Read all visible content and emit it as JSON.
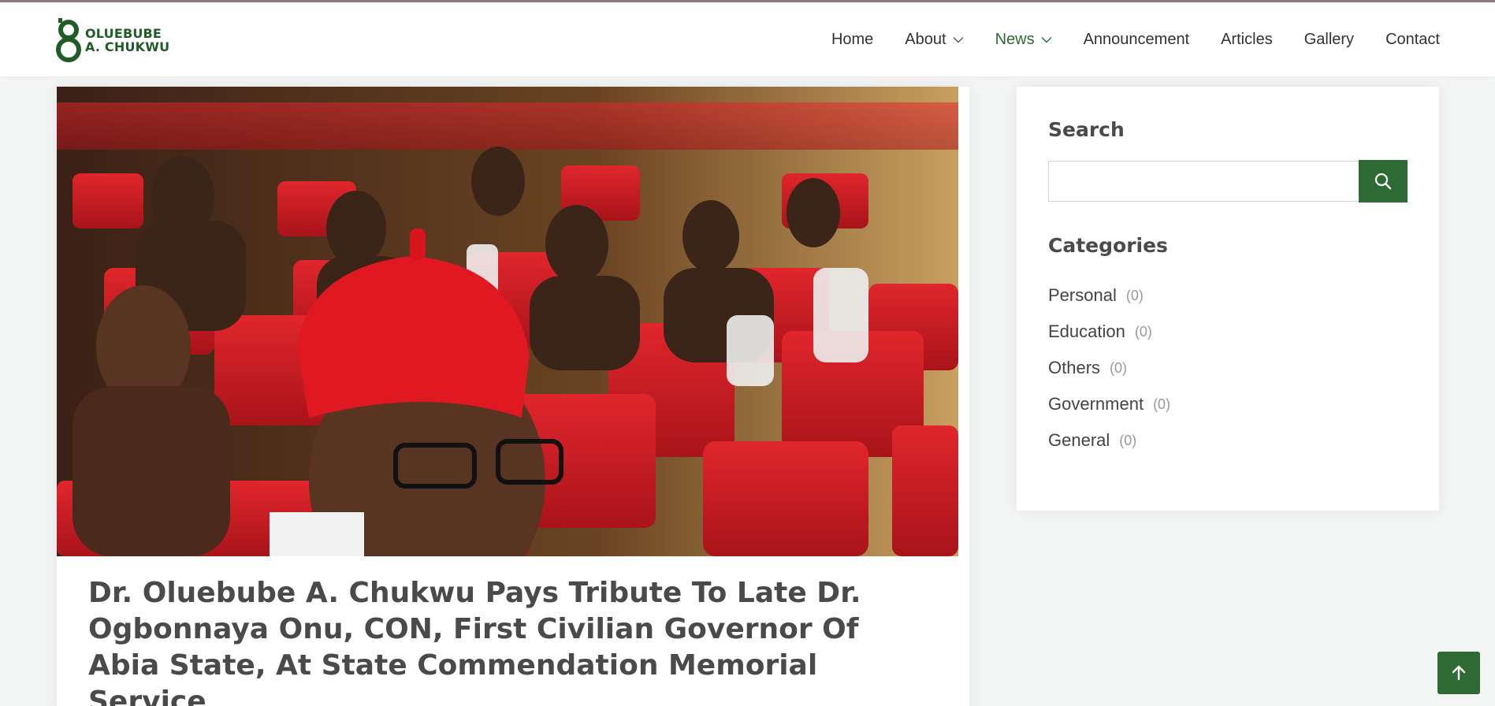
{
  "site": {
    "logo_line1": "OLUEBUBE",
    "logo_line2": "A. CHUKWU",
    "brand_color": "#2e6a34"
  },
  "nav": {
    "items": [
      {
        "label": "Home",
        "dropdown": false,
        "active": false
      },
      {
        "label": "About",
        "dropdown": true,
        "active": false
      },
      {
        "label": "News",
        "dropdown": true,
        "active": true
      },
      {
        "label": "Announcement",
        "dropdown": false,
        "active": false
      },
      {
        "label": "Articles",
        "dropdown": false,
        "active": false
      },
      {
        "label": "Gallery",
        "dropdown": false,
        "active": false
      },
      {
        "label": "Contact",
        "dropdown": false,
        "active": false
      }
    ]
  },
  "article": {
    "title": "Dr. Oluebube A. Chukwu Pays Tribute To Late Dr. Ogbonnaya Onu, CON, First Civilian Governor Of Abia State, At State Commendation Memorial Service",
    "image_icon": "photo-auditorium"
  },
  "sidebar": {
    "search": {
      "title": "Search",
      "placeholder": "",
      "button_icon": "search-icon"
    },
    "categories": {
      "title": "Categories",
      "items": [
        {
          "name": "Personal",
          "count": "(0)"
        },
        {
          "name": "Education",
          "count": "(0)"
        },
        {
          "name": "Others",
          "count": "(0)"
        },
        {
          "name": "Government",
          "count": "(0)"
        },
        {
          "name": "General",
          "count": "(0)"
        }
      ]
    }
  },
  "back_to_top": {
    "icon": "arrow-up-icon"
  }
}
